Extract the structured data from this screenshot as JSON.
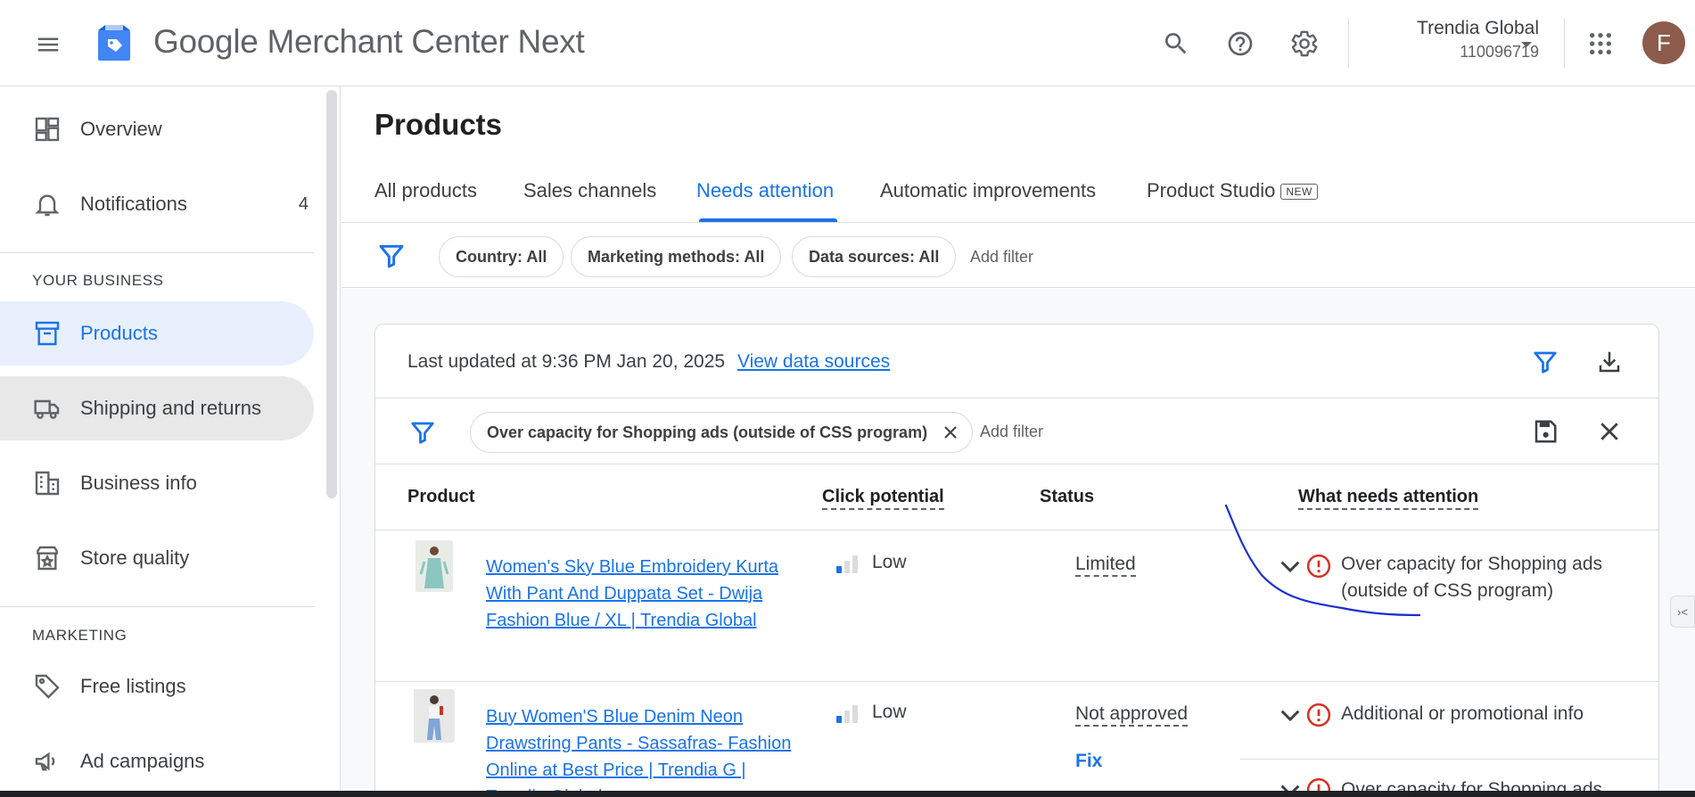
{
  "header": {
    "brand": "Google",
    "product": "Merchant Center Next",
    "account_name": "Trendia Global",
    "account_id": "110096719",
    "avatar_letter": "F"
  },
  "sidebar": {
    "items": [
      {
        "label": "Overview",
        "icon": "dashboard-icon"
      },
      {
        "label": "Notifications",
        "icon": "bell-icon",
        "badge": "4"
      },
      {
        "label": "Products",
        "icon": "archive-box-icon"
      },
      {
        "label": "Shipping and returns",
        "icon": "truck-icon"
      },
      {
        "label": "Business info",
        "icon": "building-icon"
      },
      {
        "label": "Store quality",
        "icon": "shop-badge-icon"
      },
      {
        "label": "Free listings",
        "icon": "tag-icon"
      },
      {
        "label": "Ad campaigns",
        "icon": "megaphone-icon"
      }
    ],
    "sections": [
      "YOUR BUSINESS",
      "MARKETING"
    ]
  },
  "main": {
    "title": "Products",
    "tabs": [
      {
        "label": "All products"
      },
      {
        "label": "Sales channels"
      },
      {
        "label": "Needs attention"
      },
      {
        "label": "Automatic improvements"
      },
      {
        "label": "Product Studio",
        "badge": "NEW"
      }
    ],
    "filters": {
      "chips": [
        "Country: All",
        "Marketing methods: All",
        "Data sources: All"
      ],
      "add_filter": "Add filter"
    },
    "card": {
      "updated_text": "Last updated at 9:36 PM Jan 20, 2025",
      "view_sources": "View data sources",
      "active_filter": "Over capacity for Shopping ads (outside of CSS program)",
      "add_filter": "Add filter",
      "columns": [
        "Product",
        "Click potential",
        "Status",
        "What needs attention"
      ],
      "rows": [
        {
          "product": "Women's Sky Blue Embroidery Kurta With Pant And Duppata Set - Dwija Fashion Blue / XL | Trendia Global",
          "click_potential": "Low",
          "status": "Limited",
          "attention": "Over capacity for Shopping ads (outside of CSS program)"
        },
        {
          "product": "Buy Women'S Blue Denim Neon Drawstring Pants - Sassafras- Fashion Online at Best Price | Trendia G | Trendia Global",
          "click_potential": "Low",
          "status": "Not approved",
          "fix": "Fix",
          "attention": "Additional or promotional info",
          "attention_2": "Over capacity for Shopping ads"
        }
      ]
    }
  },
  "colors": {
    "accent": "#1a73e8",
    "active_nav_bg": "#e8f0fe",
    "error": "#d93025",
    "annotation_ink": "#1a2fd1"
  }
}
